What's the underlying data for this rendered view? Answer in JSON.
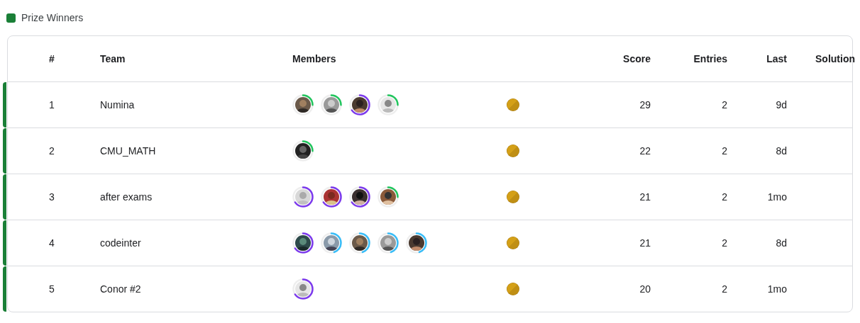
{
  "legend": [
    {
      "label": "Prize Winners",
      "color": "#1a7f37"
    }
  ],
  "table": {
    "columns": [
      "#",
      "Team",
      "Members",
      "Score",
      "Entries",
      "Last",
      "Solution"
    ],
    "rows": [
      {
        "rank": "1",
        "team": "Numina",
        "prize": true,
        "score": "29",
        "entries": "2",
        "last": "9d",
        "members": [
          {
            "color": "#22c55e"
          },
          {
            "color": "#22c55e"
          },
          {
            "color": "#7c3aed"
          },
          {
            "color": "#22c55e"
          }
        ]
      },
      {
        "rank": "2",
        "team": "CMU_MATH",
        "prize": true,
        "score": "22",
        "entries": "2",
        "last": "8d",
        "members": [
          {
            "color": "#22c55e"
          }
        ]
      },
      {
        "rank": "3",
        "team": "after exams",
        "prize": true,
        "score": "21",
        "entries": "2",
        "last": "1mo",
        "members": [
          {
            "color": "#7c3aed"
          },
          {
            "color": "#7c3aed"
          },
          {
            "color": "#7c3aed"
          },
          {
            "color": "#22c55e"
          }
        ]
      },
      {
        "rank": "4",
        "team": "codeinter",
        "prize": true,
        "score": "21",
        "entries": "2",
        "last": "8d",
        "members": [
          {
            "color": "#7c3aed"
          },
          {
            "color": "#38bdf8"
          },
          {
            "color": "#38bdf8"
          },
          {
            "color": "#38bdf8"
          },
          {
            "color": "#38bdf8"
          }
        ]
      },
      {
        "rank": "5",
        "team": "Conor #2",
        "prize": true,
        "score": "20",
        "entries": "2",
        "last": "1mo",
        "members": [
          {
            "color": "#7c3aed"
          }
        ]
      }
    ]
  }
}
